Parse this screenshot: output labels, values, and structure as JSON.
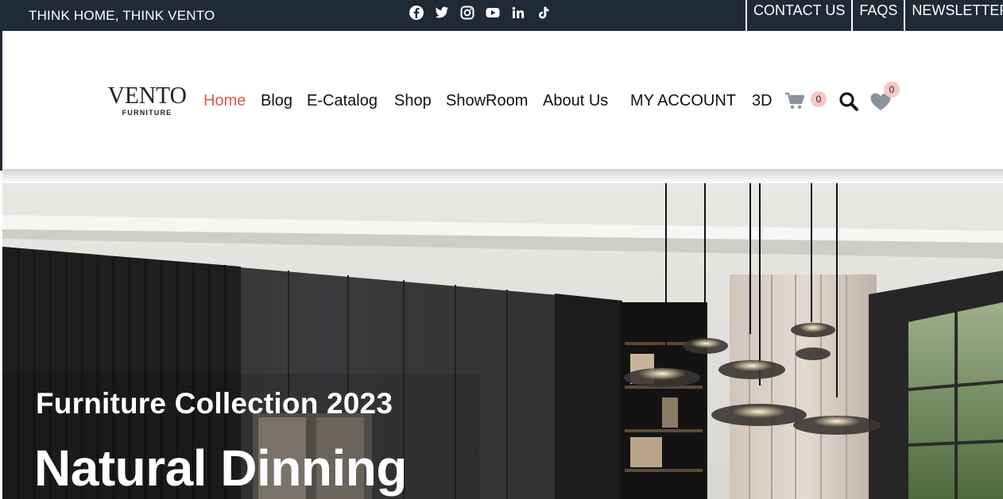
{
  "topbar": {
    "tagline": "THINK HOME, THINK VENTO",
    "socials": [
      "facebook-icon",
      "twitter-icon",
      "instagram-icon",
      "youtube-icon",
      "linkedin-icon",
      "tiktok-icon"
    ],
    "links": [
      "CONTACT US",
      "FAQS",
      "NEWSLETTER"
    ]
  },
  "header": {
    "logo": {
      "main": "VENTO",
      "sub": "FURNITURE"
    },
    "nav": [
      "Home",
      "Blog",
      "E-Catalog",
      "Shop",
      "ShowRoom",
      "About Us",
      "MY ACCOUNT",
      "3D"
    ],
    "active_item": "Home",
    "cart_count": "0",
    "wishlist_count": "0"
  },
  "hero": {
    "subtitle": "Furniture Collection 2023",
    "title": "Natural Dinning"
  },
  "colors": {
    "topbar_bg": "#1f2a37",
    "accent": "#e2574c",
    "badge_bg": "#f7c7c4",
    "icon_gray": "#8a929c"
  }
}
